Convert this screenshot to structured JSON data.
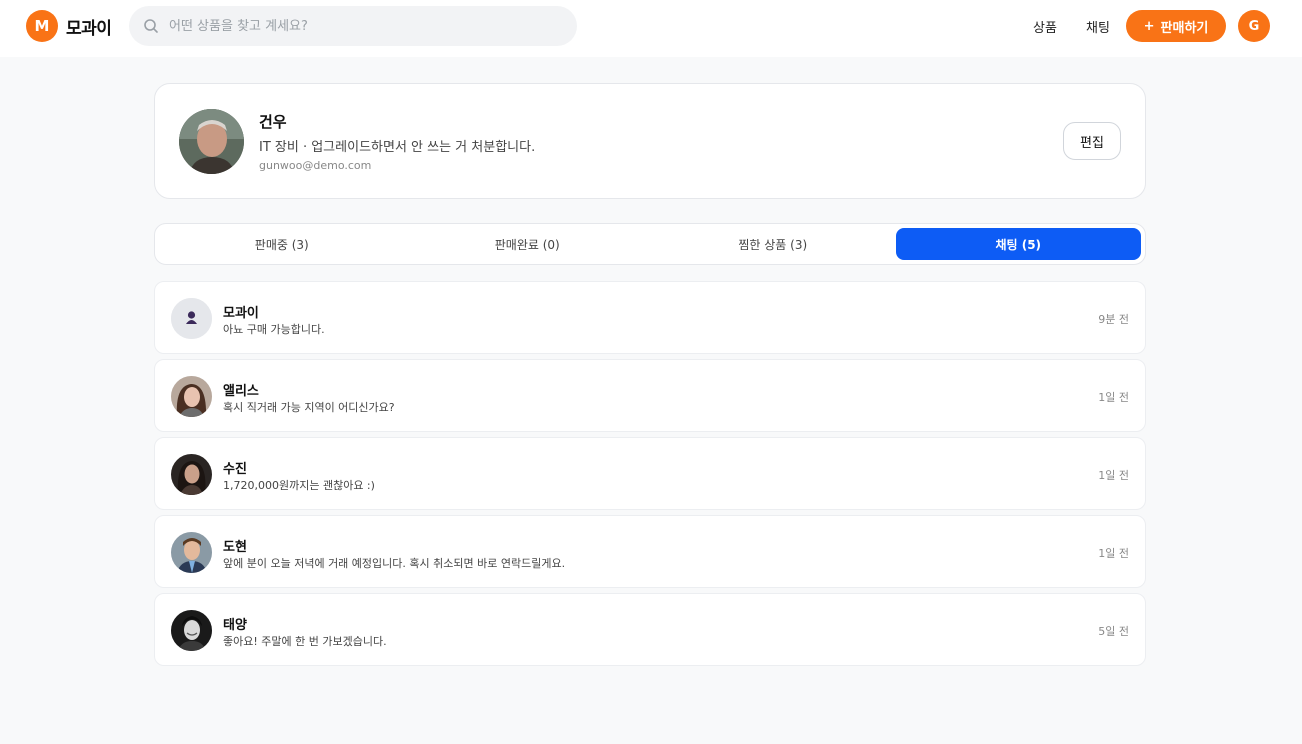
{
  "header": {
    "logo_letter": "M",
    "logo_text": "모과이",
    "search_placeholder": "어떤 상품을 찾고 계세요?",
    "nav_products": "상품",
    "nav_chat": "채팅",
    "sell_button": "판매하기",
    "sell_icon": "+",
    "user_initial": "G",
    "accent_color": "#f97316"
  },
  "profile": {
    "name": "건우",
    "bio": "IT 장비 · 업그레이드하면서 안 쓰는 거 처분합니다.",
    "email": "gunwoo@demo.com",
    "edit_button": "편집"
  },
  "tabs": [
    {
      "label": "판매중 (3)",
      "active": false
    },
    {
      "label": "판매완료 (0)",
      "active": false
    },
    {
      "label": "찜한 상품 (3)",
      "active": false
    },
    {
      "label": "채팅 (5)",
      "active": true
    }
  ],
  "tab_active_color": "#0d5cf5",
  "chats": [
    {
      "name": "모과이",
      "message": "아뇨 구매 가능합니다.",
      "time": "9분 전",
      "avatar": "default-user-icon"
    },
    {
      "name": "앨리스",
      "message": "혹시 직거래 가능 지역이 어디신가요?",
      "time": "1일 전",
      "avatar": "photo"
    },
    {
      "name": "수진",
      "message": "1,720,000원까지는 괜찮아요 :)",
      "time": "1일 전",
      "avatar": "photo"
    },
    {
      "name": "도현",
      "message": "앞에 분이 오늘 저녁에 거래 예정입니다. 혹시 취소되면 바로 연락드릴게요.",
      "time": "1일 전",
      "avatar": "photo"
    },
    {
      "name": "태양",
      "message": "좋아요! 주말에 한 번 가보겠습니다.",
      "time": "5일 전",
      "avatar": "photo"
    }
  ]
}
